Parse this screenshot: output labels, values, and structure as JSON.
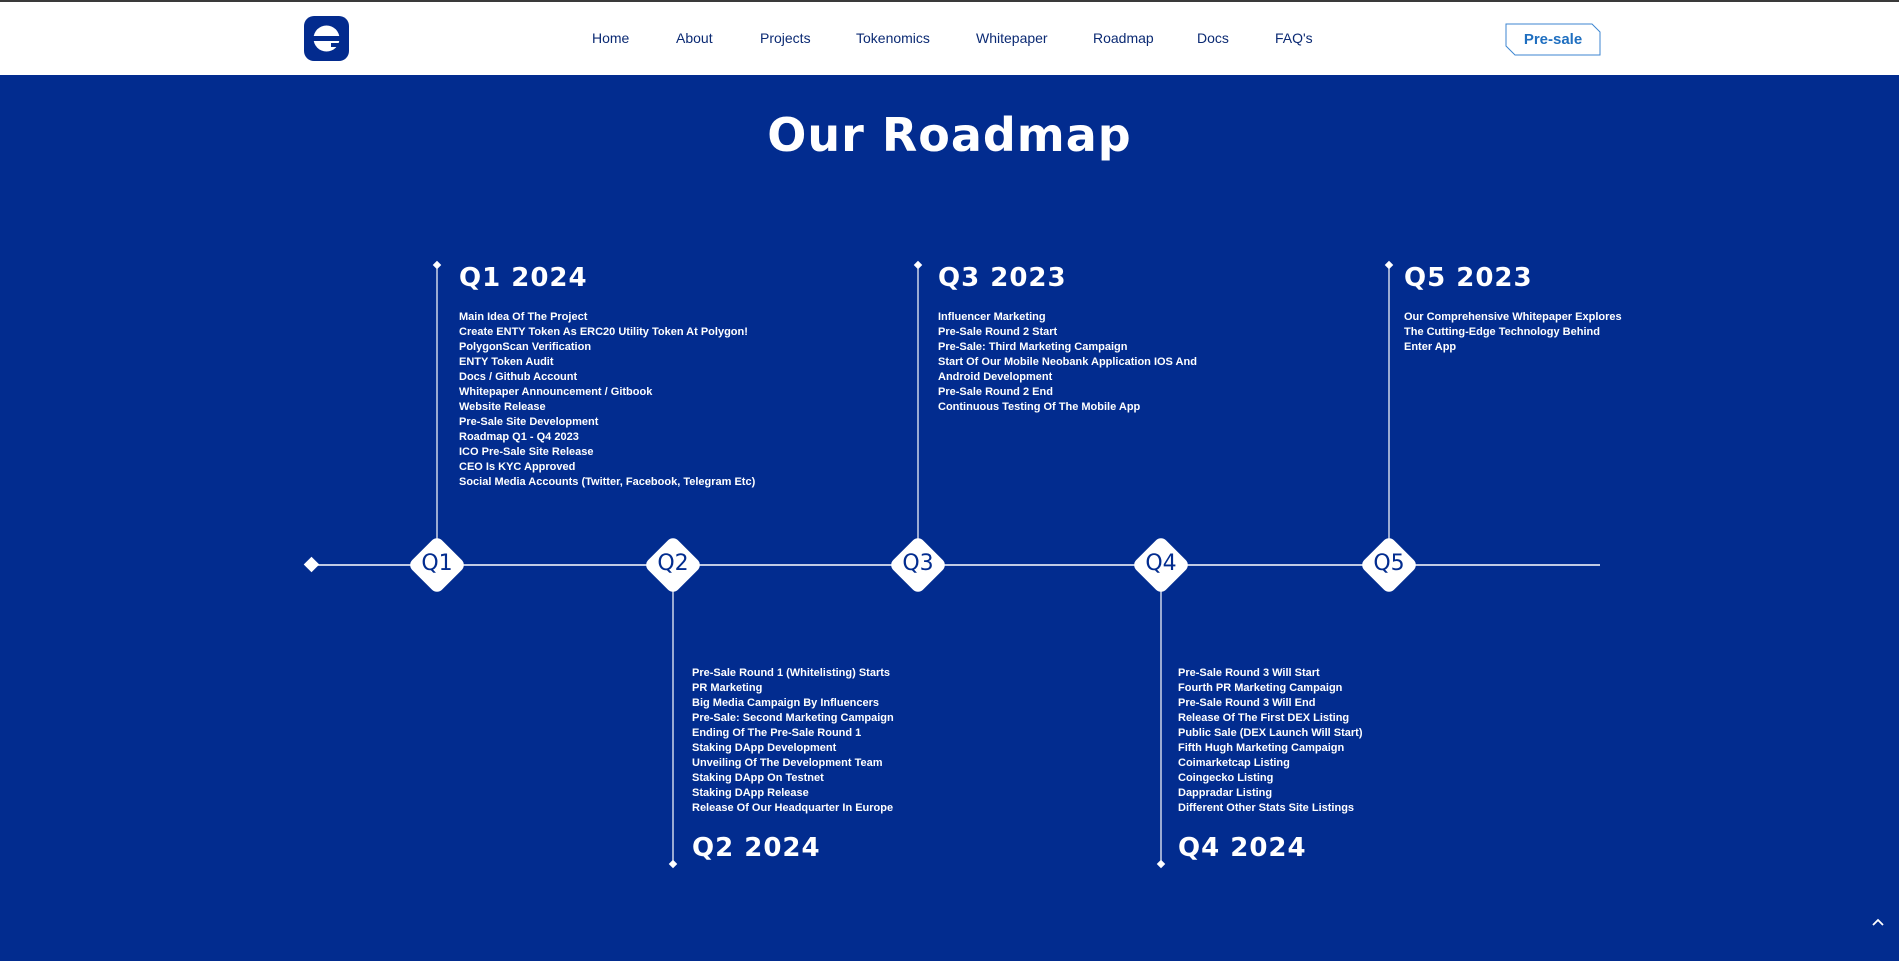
{
  "nav": {
    "logo": "e",
    "links": [
      "Home",
      "About",
      "Projects",
      "Tokenomics",
      "Whitepaper",
      "Roadmap",
      "Docs",
      "FAQ's"
    ],
    "cta": "Pre-sale"
  },
  "page_title": "Our Roadmap",
  "milestones": [
    "Q1",
    "Q2",
    "Q3",
    "Q4",
    "Q5"
  ],
  "phases": [
    {
      "title": "Q1 2024",
      "items": [
        "Main Idea Of The Project",
        "Create ENTY Token As ERC20 Utility Token At Polygon!",
        "PolygonScan Verification",
        "ENTY Token Audit",
        "Docs / Github Account",
        "Whitepaper Announcement / Gitbook",
        "Website Release",
        "Pre-Sale Site Development",
        "Roadmap Q1 - Q4 2023",
        "ICO Pre-Sale Site Release",
        "CEO Is KYC Approved",
        "Social Media Accounts (Twitter, Facebook, Telegram Etc)"
      ]
    },
    {
      "title": "Q2 2024",
      "items": [
        "Pre-Sale Round 1 (Whitelisting) Starts",
        "PR Marketing",
        "Big Media Campaign By Influencers",
        "Pre-Sale: Second Marketing Campaign",
        "Ending Of The Pre-Sale Round 1",
        "Staking DApp Development",
        "Unveiling Of The Development Team",
        "Staking DApp On Testnet",
        "Staking DApp Release",
        "Release Of Our Headquarter In Europe"
      ]
    },
    {
      "title": "Q3 2023",
      "items": [
        "Influencer Marketing",
        "Pre-Sale Round 2 Start",
        "Pre-Sale: Third Marketing Campaign",
        "Start Of Our Mobile Neobank Application IOS And Android Development",
        "Pre-Sale Round 2 End",
        "Continuous Testing Of The Mobile App"
      ]
    },
    {
      "title": "Q4 2024",
      "items": [
        "Pre-Sale Round 3 Will Start",
        "Fourth PR Marketing Campaign",
        "Pre-Sale Round 3 Will End",
        "Release Of The First DEX Listing",
        "Public Sale (DEX Launch Will Start)",
        "Fifth Hugh Marketing Campaign",
        "Coimarketcap Listing",
        "Coingecko Listing",
        "Dappradar Listing",
        "Different Other Stats Site Listings"
      ]
    },
    {
      "title": "Q5 2023",
      "items": [
        "Our Comprehensive Whitepaper Explores The Cutting-Edge Technology Behind Enter App"
      ]
    }
  ]
}
